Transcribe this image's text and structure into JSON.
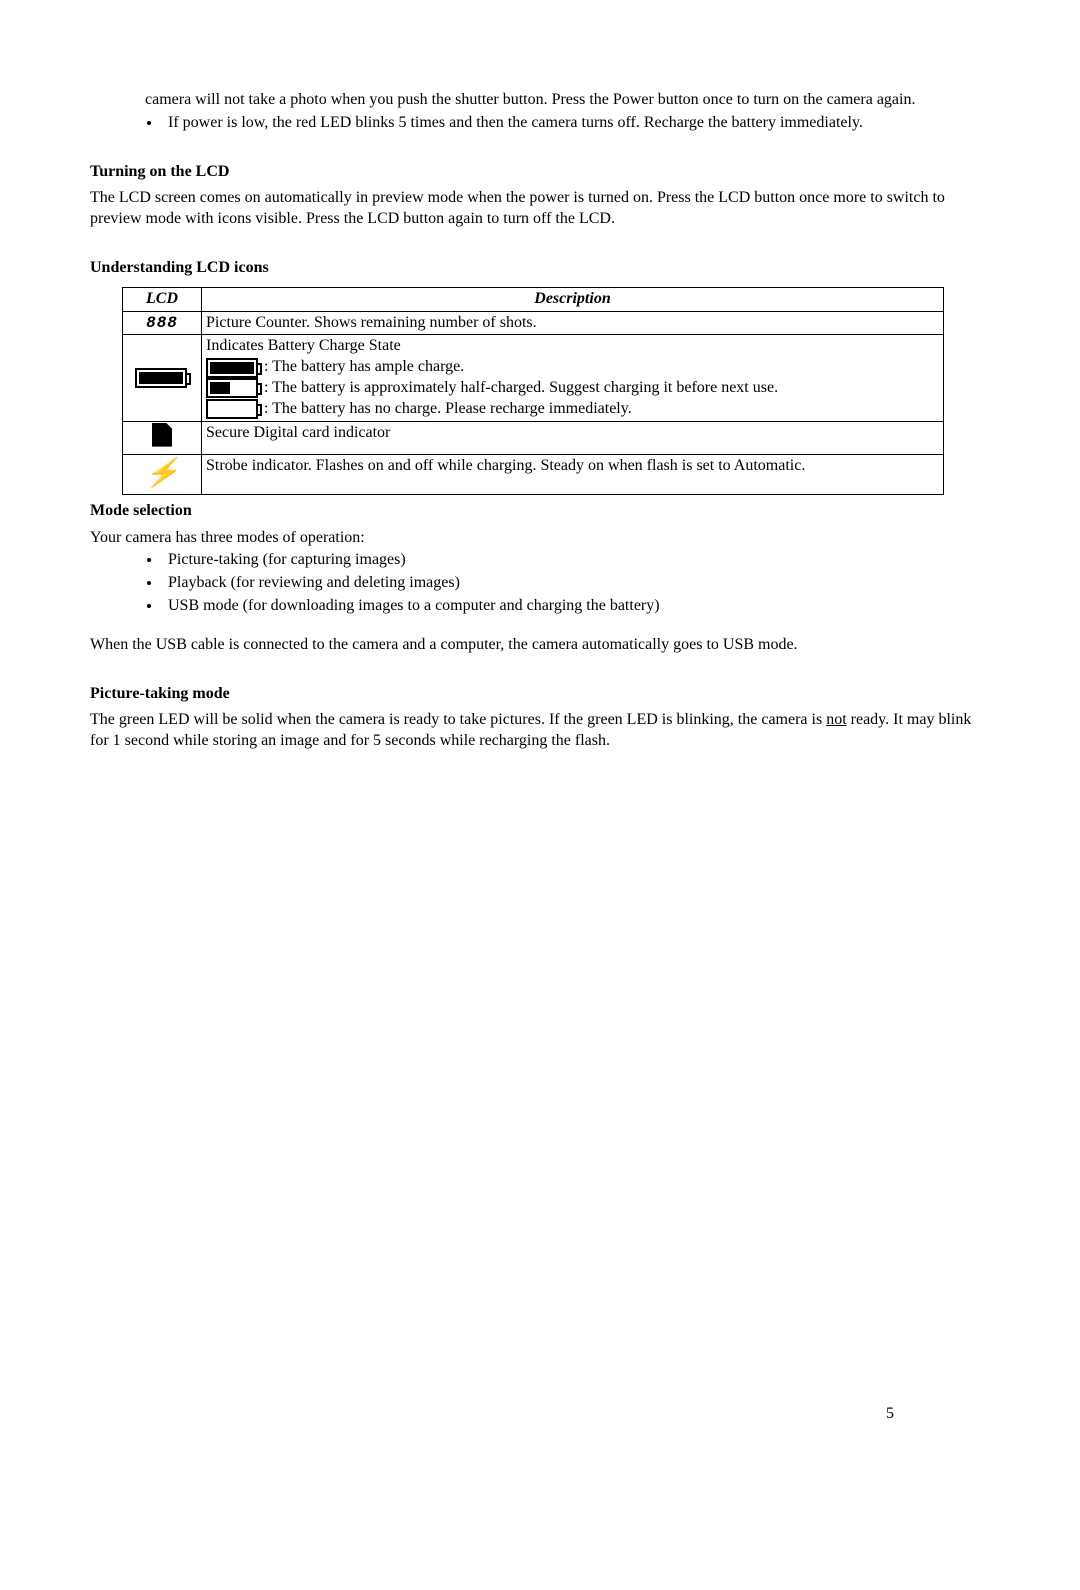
{
  "intro": {
    "line1": "camera will not take a photo when you push the shutter button. Press the Power button once to turn on the camera again.",
    "bullet1": "If power is low, the red LED blinks 5 times and then the camera turns off.  Recharge the battery immediately."
  },
  "sections": {
    "turning_lcd": {
      "heading": "Turning on the LCD",
      "body": "The LCD screen comes on automatically in preview mode when the power is turned on. Press the LCD button once more to switch to preview mode with icons visible. Press the LCD button again to turn off the LCD."
    },
    "understanding": {
      "heading": "Understanding LCD icons"
    },
    "mode_selection": {
      "heading": "Mode selection",
      "intro": "Your camera has three modes of operation:",
      "items": [
        "Picture-taking (for capturing images)",
        "Playback (for reviewing and deleting images)",
        "USB mode (for downloading images to a computer and charging the battery)"
      ],
      "after": "When the USB cable is connected to the camera and a computer, the camera automatically goes to USB mode."
    },
    "picture_taking": {
      "heading": "Picture-taking mode",
      "body_pre": "The green LED will be solid when the camera is ready to take pictures.  If the green LED is blinking, the camera is ",
      "not": "not",
      "body_post": " ready.  It may blink for 1 second while storing an image and for 5 seconds while recharging the flash."
    }
  },
  "table": {
    "headers": {
      "lcd": "LCD",
      "desc": "Description"
    },
    "rows": {
      "counter": {
        "icon": "888",
        "desc": "Picture Counter. Shows remaining number of shots."
      },
      "battery": {
        "title": "Indicates Battery Charge State",
        "full": " : The battery has ample charge.",
        "half": " : The battery is approximately half-charged.  Suggest charging it before next use.",
        "empty": " : The battery has no charge.  Please recharge immediately."
      },
      "sd": {
        "desc": "Secure Digital card indicator"
      },
      "strobe": {
        "desc": "Strobe indicator. Flashes on and off while charging.  Steady on when flash is set to Automatic."
      }
    }
  },
  "page_number": "5"
}
